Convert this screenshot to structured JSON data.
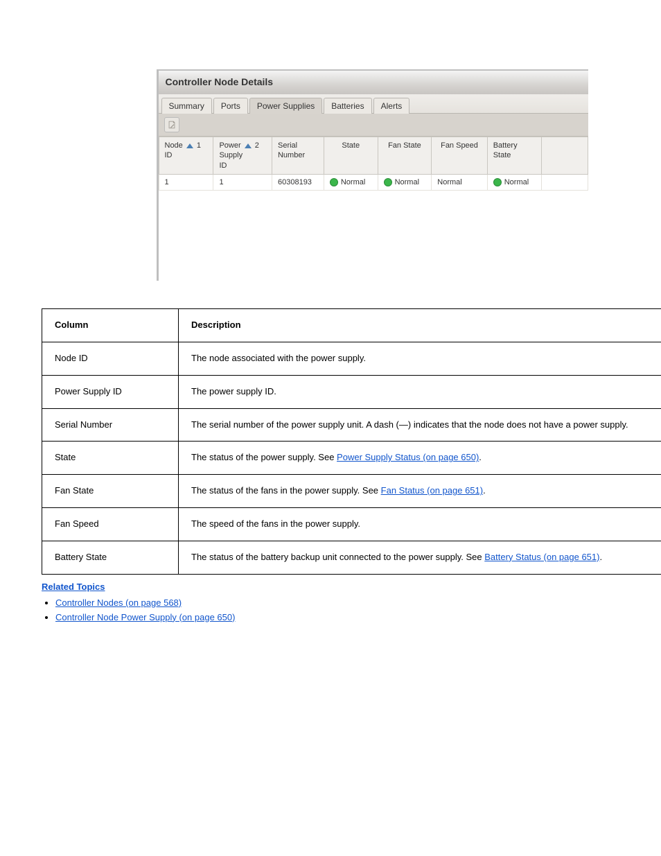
{
  "screenshot": {
    "title": "Controller Node Details",
    "tabs": [
      {
        "label": "Summary"
      },
      {
        "label": "Ports"
      },
      {
        "label": "Power Supplies",
        "active": true
      },
      {
        "label": "Batteries"
      },
      {
        "label": "Alerts"
      }
    ],
    "toolbar_icon": "document-edit-icon",
    "columns": [
      {
        "label_a": "Node",
        "label_b": "ID",
        "sort_order": "1"
      },
      {
        "label_a": "Power",
        "label_b": "Supply",
        "label_c": "ID",
        "sort_order": "2"
      },
      {
        "label_a": "Serial",
        "label_b": "Number"
      },
      {
        "label_a": "State"
      },
      {
        "label_a": "Fan State"
      },
      {
        "label_a": "Fan Speed"
      },
      {
        "label_a": "Battery",
        "label_b": "State"
      }
    ],
    "row": {
      "node_id": "1",
      "ps_id": "1",
      "serial": "60308193",
      "state": "Normal",
      "fan_state": "Normal",
      "fan_speed": "Normal",
      "battery_state": "Normal"
    }
  },
  "desc": {
    "header": {
      "col": "Column",
      "desc": "Description"
    },
    "rows": [
      {
        "col": "Node ID",
        "desc": "The node associated with the power supply."
      },
      {
        "col": "Power Supply ID",
        "desc": "The power supply ID."
      },
      {
        "col": "Serial Number",
        "desc": "The serial number of the power supply unit. A dash (—) indicates that the node does not have a power supply."
      },
      {
        "col": "State",
        "desc_pre": "The status of the power supply. See ",
        "link": "Power Supply Status (on page 650)",
        "desc_post": "."
      },
      {
        "col": "Fan State",
        "desc_pre": "The status of the fans in the power supply. See ",
        "link": "Fan Status (on page 651)",
        "desc_post": "."
      },
      {
        "col": "Fan Speed",
        "desc": "The speed of the fans in the power supply."
      },
      {
        "col": "Battery State",
        "desc_pre": "The status of the battery backup unit connected to the power supply. See ",
        "link": "Battery Status (on page 651)",
        "desc_post": "."
      }
    ]
  },
  "related": {
    "header": "Related Topics",
    "links": [
      "Controller Nodes (on page 568)",
      "Controller Node Power Supply (on page 650)"
    ]
  }
}
